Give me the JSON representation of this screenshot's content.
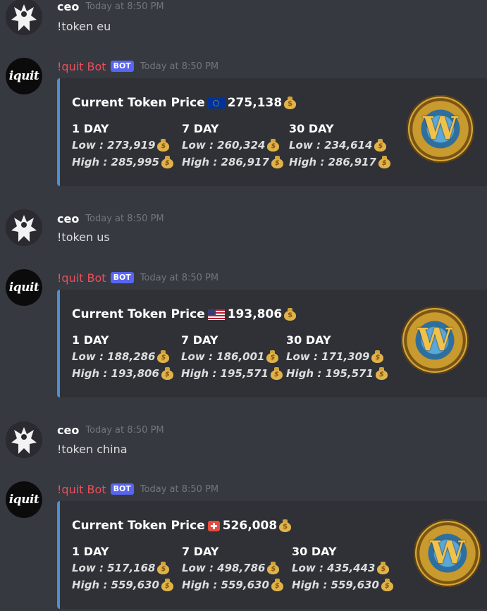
{
  "messages": [
    {
      "type": "user",
      "username": "ceo",
      "timestamp": "Today at 8:50 PM",
      "text": "!token eu"
    },
    {
      "type": "bot",
      "username": "!quit Bot",
      "badge": "BOT",
      "timestamp": "Today at 8:50 PM",
      "avatar_text": "iquit",
      "embed": {
        "title": "Current Token Price",
        "flag": "eu",
        "price": "275,138",
        "columns": [
          {
            "label": "1 DAY",
            "low": "Low : 273,919",
            "high": "High : 285,995"
          },
          {
            "label": "7 DAY",
            "low": "Low : 260,324",
            "high": "High : 286,917"
          },
          {
            "label": "30 DAY",
            "low": "Low : 234,614",
            "high": "High : 286,917"
          }
        ]
      }
    },
    {
      "type": "user",
      "username": "ceo",
      "timestamp": "Today at 8:50 PM",
      "text": "!token us"
    },
    {
      "type": "bot",
      "username": "!quit Bot",
      "badge": "BOT",
      "timestamp": "Today at 8:50 PM",
      "avatar_text": "iquit",
      "embed": {
        "title": "Current Token Price",
        "flag": "us",
        "price": "193,806",
        "columns": [
          {
            "label": "1 DAY",
            "low": "Low : 188,286",
            "high": "High : 193,806"
          },
          {
            "label": "7 DAY",
            "low": "Low : 186,001",
            "high": "High : 195,571"
          },
          {
            "label": "30 DAY",
            "low": "Low : 171,309",
            "high": "High : 195,571"
          }
        ]
      }
    },
    {
      "type": "user",
      "username": "ceo",
      "timestamp": "Today at 8:50 PM",
      "text": "!token china"
    },
    {
      "type": "bot",
      "username": "!quit Bot",
      "badge": "BOT",
      "timestamp": "Today at 8:50 PM",
      "avatar_text": "iquit",
      "embed": {
        "title": "Current Token Price",
        "flag": "china",
        "price": "526,008",
        "columns": [
          {
            "label": "1 DAY",
            "low": "Low : 517,168",
            "high": "High : 559,630"
          },
          {
            "label": "7 DAY",
            "low": "Low : 498,786",
            "high": "High : 559,630"
          },
          {
            "label": "30 DAY",
            "low": "Low : 435,443",
            "high": "High : 559,630"
          }
        ]
      }
    }
  ]
}
